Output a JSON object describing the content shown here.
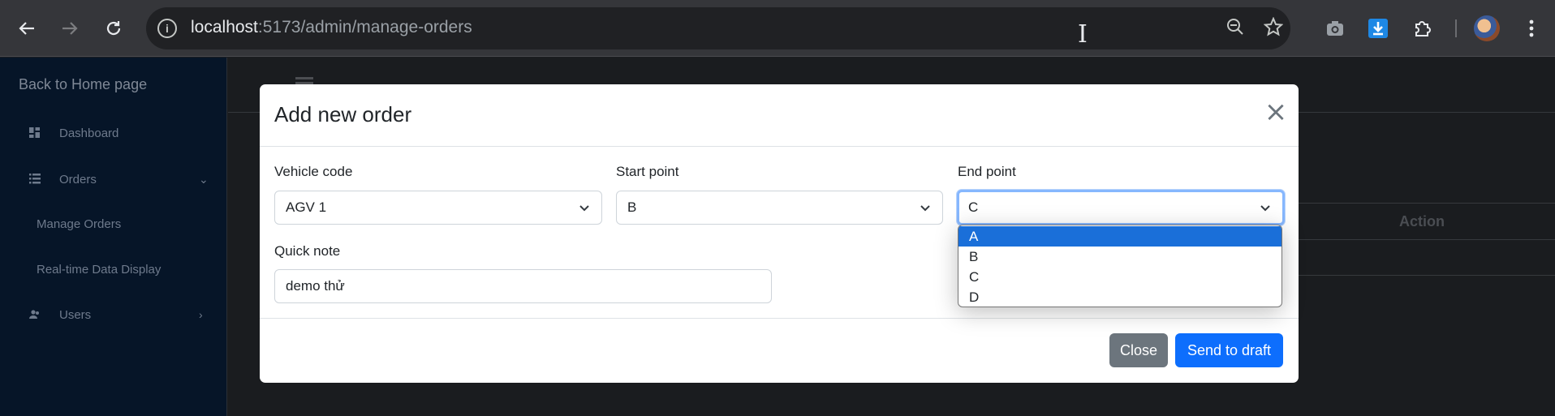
{
  "browser": {
    "url_host": "localhost",
    "url_path": ":5173/admin/manage-orders",
    "icons": [
      "back-arrow-icon",
      "forward-arrow-icon",
      "reload-icon",
      "site-info-icon",
      "zoom-out-icon",
      "bookmark-star-icon",
      "camera-icon",
      "download-icon",
      "extensions-puzzle-icon",
      "profile-avatar",
      "menu-dots-icon"
    ]
  },
  "sidebar": {
    "back_link": "Back to Home page",
    "items": [
      {
        "label": "Dashboard",
        "icon": "dashboard-icon"
      },
      {
        "label": "Orders",
        "icon": "list-icon",
        "chevron": "⌄"
      },
      {
        "label": "Users",
        "icon": "users-icon",
        "chevron": "›"
      }
    ],
    "sub_items": [
      "Manage Orders",
      "Real-time Data Display"
    ]
  },
  "page": {
    "table_header_action": "Action"
  },
  "modal": {
    "title": "Add new order",
    "close_symbol": "×",
    "vehicle_label": "Vehicle code",
    "vehicle_value": "AGV 1",
    "start_label": "Start point",
    "start_value": "B",
    "end_label": "End point",
    "end_value": "C",
    "note_label": "Quick note",
    "note_value": "demo thử",
    "end_options": [
      "A",
      "B",
      "C",
      "D"
    ],
    "close_button": "Close",
    "send_button": "Send to draft"
  },
  "colors": {
    "primary": "#0d6efd",
    "secondary": "#6c757d",
    "sidebar_bg": "#061528",
    "dropdown_highlight": "#1a6fd9"
  }
}
